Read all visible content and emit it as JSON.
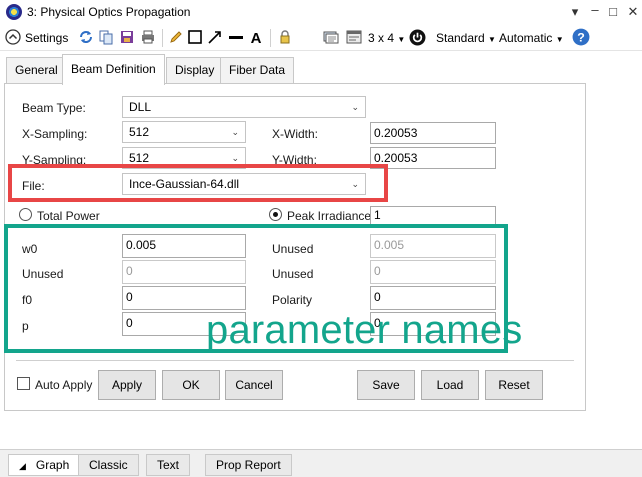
{
  "window": {
    "title": "3: Physical Optics Propagation"
  },
  "toolbar": {
    "settings_label": "Settings",
    "layout_label": "3 x 4",
    "standard_label": "Standard",
    "automatic_label": "Automatic"
  },
  "tabs": [
    {
      "label": "General"
    },
    {
      "label": "Beam Definition"
    },
    {
      "label": "Display"
    },
    {
      "label": "Fiber Data"
    }
  ],
  "form": {
    "beam_type": {
      "label": "Beam Type:",
      "value": "DLL"
    },
    "x_sampling": {
      "label": "X-Sampling:",
      "value": "512"
    },
    "y_sampling": {
      "label": "Y-Sampling:",
      "value": "512"
    },
    "x_width": {
      "label": "X-Width:",
      "value": "0.20053"
    },
    "y_width": {
      "label": "Y-Width:",
      "value": "0.20053"
    },
    "file": {
      "label": "File:",
      "value": "Ince-Gaussian-64.dll"
    },
    "total_power": {
      "label": "Total Power"
    },
    "peak_irradiance": {
      "label": "Peak Irradiance",
      "value": "1"
    }
  },
  "params": {
    "left": [
      {
        "label": "w0",
        "value": "0.005"
      },
      {
        "label": "Unused",
        "value": "0"
      },
      {
        "label": "f0",
        "value": "0"
      },
      {
        "label": "p",
        "value": "0"
      }
    ],
    "right": [
      {
        "label": "Unused",
        "value": "0.005"
      },
      {
        "label": "Unused",
        "value": "0"
      },
      {
        "label": "Polarity",
        "value": "0"
      },
      {
        "label": "",
        "value": "0"
      }
    ]
  },
  "buttons": {
    "auto_apply": "Auto Apply",
    "apply": "Apply",
    "ok": "OK",
    "cancel": "Cancel",
    "save": "Save",
    "load": "Load",
    "reset": "Reset"
  },
  "bottom_tabs": [
    {
      "label": "Graph"
    },
    {
      "label": "Classic"
    },
    {
      "label": "Text"
    },
    {
      "label": "Prop Report"
    }
  ],
  "annotation": {
    "text": "parameter names"
  },
  "colors": {
    "annotation_red": "#e84646",
    "annotation_green": "#13a58c"
  }
}
